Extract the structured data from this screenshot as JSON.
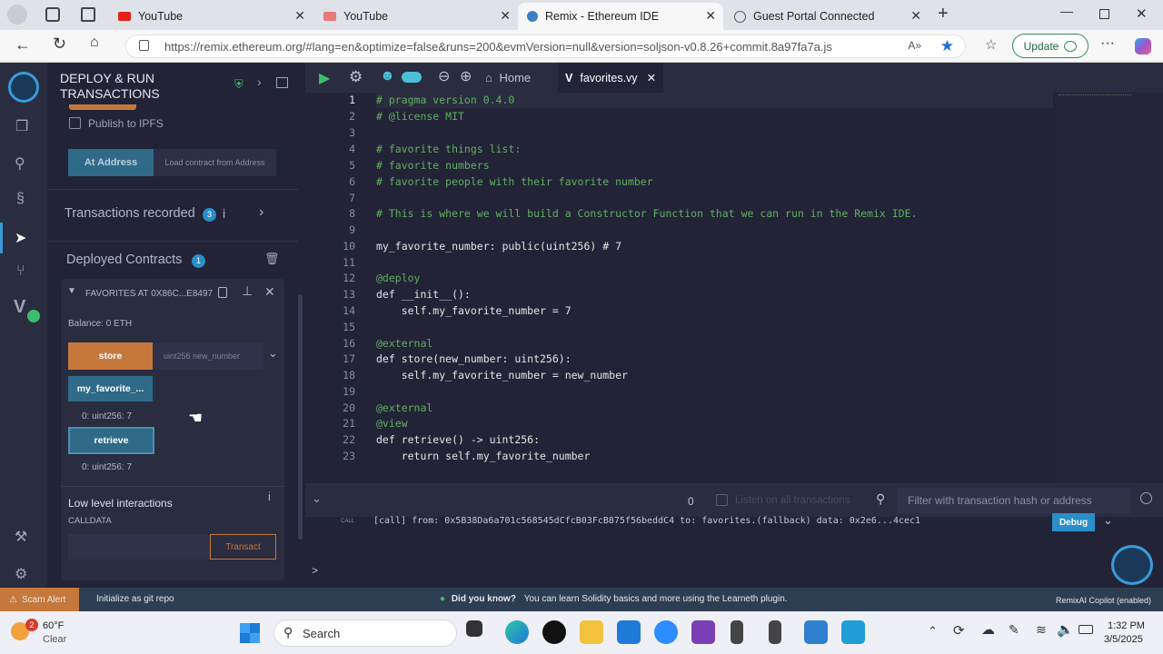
{
  "browser": {
    "tabs": [
      {
        "label": "YouTube"
      },
      {
        "label": "YouTube"
      },
      {
        "label": "Remix - Ethereum IDE"
      },
      {
        "label": "Guest Portal Connected"
      }
    ],
    "url": "https://remix.ethereum.org/#lang=en&optimize=false&runs=200&evmVersion=null&version=soljson-v0.8.26+commit.8a97fa7a.js",
    "update_label": "Update"
  },
  "side": {
    "title_line1": "DEPLOY & RUN",
    "title_line2": "TRANSACTIONS",
    "publish_label": "Publish to IPFS",
    "at_address_label": "At Address",
    "load_contract_label": "Load contract from Address",
    "tx_recorded_label": "Transactions recorded",
    "tx_recorded_count": "3",
    "deployed_label": "Deployed Contracts",
    "deployed_count": "1",
    "contract_name": "FAVORITES AT 0X86C...E8497",
    "balance": "Balance: 0 ETH",
    "store_label": "store",
    "store_param_placeholder": "uint256 new_number",
    "my_fav_label": "my_favorite_...",
    "my_fav_result": "0: uint256: 7",
    "retrieve_label": "retrieve",
    "retrieve_result": "0: uint256: 7",
    "low_level_label": "Low level interactions",
    "calldata_label": "CALLDATA",
    "transact_label": "Transact"
  },
  "editor": {
    "home_tab": "Home",
    "file_tab": "favorites.vy",
    "line_numbers": [
      "1",
      "2",
      "3",
      "4",
      "5",
      "6",
      "7",
      "8",
      "9",
      "10",
      "11",
      "12",
      "13",
      "14",
      "15",
      "16",
      "17",
      "18",
      "19",
      "20",
      "21",
      "22",
      "23"
    ],
    "lines": [
      "# pragma version 0.4.0",
      "# @license MIT",
      "",
      "# favorite things list:",
      "# favorite numbers",
      "# favorite people with their favorite number",
      "",
      "# This is where we will build a Constructor Function that we can run in the Remix IDE.",
      "",
      "my_favorite_number: public(uint256) # 7",
      "",
      "@deploy",
      "def __init__():",
      "    self.my_favorite_number = 7",
      "",
      "@external",
      "def store(new_number: uint256):",
      "    self.my_favorite_number = new_number",
      "",
      "@external",
      "@view",
      "def retrieve() -> uint256:",
      "    return self.my_favorite_number"
    ]
  },
  "terminal": {
    "count": "0",
    "listen_label": "Listen on all transactions",
    "filter_placeholder": "Filter with transaction hash or address",
    "call_tag": "CALL",
    "call_line": "[call]  from: 0x5B38Da6a701c568545dCfcB03FcB875f56beddC4 to: favorites.(fallback) data: 0x2e6...4cec1",
    "debug_label": "Debug",
    "prompt": ">"
  },
  "status": {
    "scam_alert": "Scam Alert",
    "init_git": "Initialize as git repo",
    "did_you_know": "Did you know?",
    "tip": "You can learn Solidity basics and more using the Learneth plugin.",
    "copilot": "RemixAI Copilot (enabled)"
  },
  "taskbar": {
    "weather_temp": "60°F",
    "weather_desc": "Clear",
    "weather_badge": "2",
    "search_label": "Search",
    "time": "1:32 PM",
    "date": "3/5/2025"
  }
}
